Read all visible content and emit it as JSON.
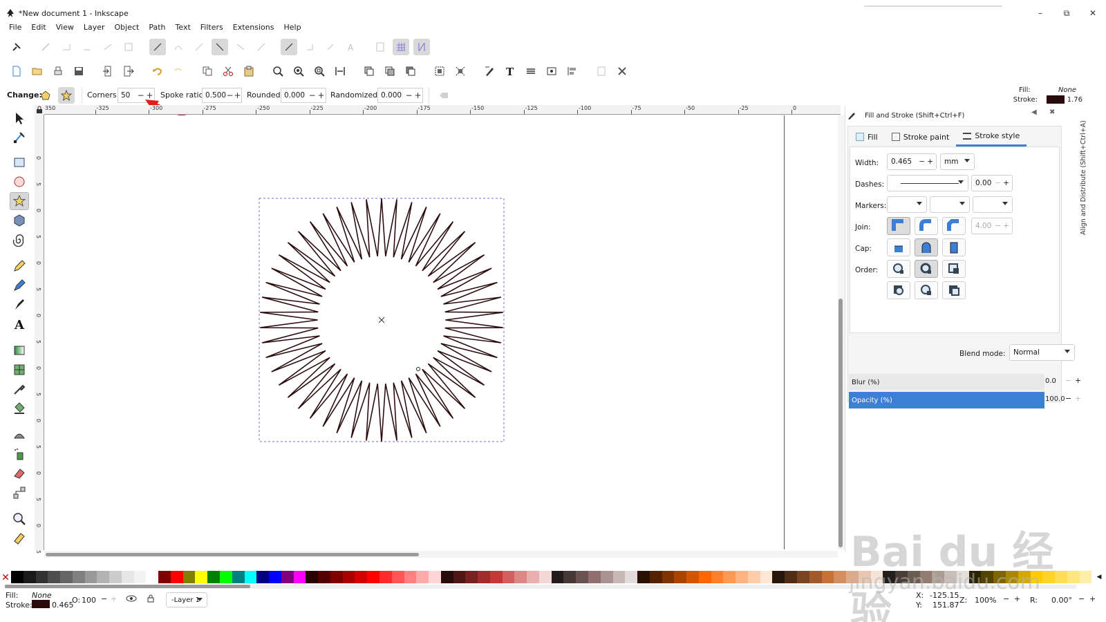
{
  "window": {
    "title": "*New document 1 - Inkscape",
    "minimize_glyph": "–",
    "maximize_glyph": "⧉",
    "close_glyph": "✕"
  },
  "menubar": [
    "File",
    "Edit",
    "View",
    "Layer",
    "Object",
    "Path",
    "Text",
    "Filters",
    "Extensions",
    "Help"
  ],
  "star_controls": {
    "change_label": "Change:",
    "corners_label": "Corners:",
    "corners_value": "50",
    "spoke_label": "Spoke ratio:",
    "spoke_value": "0.500",
    "rounded_label": "Rounded:",
    "rounded_value": "0.000",
    "randomized_label": "Randomized:",
    "randomized_value": "0.000",
    "minus": "−",
    "plus": "+"
  },
  "style_indicator": {
    "fill_label": "Fill:",
    "fill_value": "None",
    "stroke_label": "Stroke:",
    "stroke_value": "1.76",
    "stroke_color": "#2a0a0a"
  },
  "rulers": {
    "h_ticks": [
      "-350",
      "-325",
      "-300",
      "-275",
      "-250",
      "-225",
      "-200",
      "-175",
      "-150",
      "-125",
      "-100",
      "-75",
      "-50",
      "-25",
      "0"
    ],
    "v_ticks": [
      "0",
      "5",
      "0",
      "5",
      "0",
      "5",
      "0",
      "5",
      "0",
      "5",
      "0",
      "5",
      "0",
      "5",
      "0",
      "5"
    ]
  },
  "canvas": {
    "star_corners": 50,
    "spoke_ratio": 0.5,
    "stroke_color": "#2b0d10",
    "bbox_color": "#6b6bd6"
  },
  "dock": {
    "title": "Fill and Stroke (Shift+Ctrl+F)",
    "vertical_tab": "Align and Distribute (Shift+Ctrl+A)",
    "tabs": [
      "Fill",
      "Stroke paint",
      "Stroke style"
    ],
    "width_label": "Width:",
    "width_value": "0.465",
    "width_unit": "mm",
    "dashes_label": "Dashes:",
    "dash_offset": "0.00",
    "markers_label": "Markers:",
    "join_label": "Join:",
    "miter_value": "4.00",
    "cap_label": "Cap:",
    "order_label": "Order:",
    "blend_label": "Blend mode:",
    "blend_value": "Normal",
    "blur_label": "Blur (%)",
    "blur_value": "0.0",
    "opacity_label": "Opacity (%)",
    "opacity_value": "100.0",
    "accent_color": "#3b80d6"
  },
  "palette": {
    "none_glyph": "✕",
    "colors": [
      "#000000",
      "#1a1a1a",
      "#333333",
      "#4d4d4d",
      "#666666",
      "#808080",
      "#999999",
      "#b3b3b3",
      "#cccccc",
      "#e6e6e6",
      "#f2f2f2",
      "#ffffff",
      "#800000",
      "#ff0000",
      "#808000",
      "#ffff00",
      "#008000",
      "#00ff00",
      "#008080",
      "#00ffff",
      "#000080",
      "#0000ff",
      "#800080",
      "#ff00ff",
      "#2b0000",
      "#550000",
      "#800000",
      "#aa0000",
      "#d40000",
      "#ff0000",
      "#ff2a2a",
      "#ff5555",
      "#ff8080",
      "#ffaaaa",
      "#ffd5d5",
      "#280b0b",
      "#501616",
      "#782121",
      "#a02c2c",
      "#c83737",
      "#d35f5f",
      "#de8787",
      "#e9afaf",
      "#f4d7d7",
      "#241c1c",
      "#483737",
      "#6c5353",
      "#916f6f",
      "#ac9393",
      "#c8b7b7",
      "#e3dbdb",
      "#2b1100",
      "#552200",
      "#803300",
      "#aa4400",
      "#d45500",
      "#ff6600",
      "#ff7f2a",
      "#ff9955",
      "#ffb380",
      "#ffccaa",
      "#ffe6d5",
      "#28170b",
      "#502d16",
      "#784421",
      "#a05a2c",
      "#c87137",
      "#d38d5f",
      "#deaa87",
      "#e9c6af",
      "#f4e3d7",
      "#241f1c",
      "#483e37",
      "#6c5d53",
      "#917c6f",
      "#ac9d93",
      "#c8beb7",
      "#e3dedb",
      "#2b2200",
      "#554400",
      "#806600",
      "#aa8800",
      "#d4aa00",
      "#ffcc00",
      "#ffd42a",
      "#ffdd55",
      "#ffe680",
      "#ffeeaa"
    ]
  },
  "statusbar": {
    "fill_label": "Fill:",
    "fill_value": "None",
    "stroke_label": "Stroke:",
    "stroke_value": "0.465",
    "opacity_label": "O:",
    "opacity_value": "100",
    "layer": "-Layer 1",
    "x_label": "X:",
    "x_value": "-125.15",
    "y_label": "Y:",
    "y_value": "151.87",
    "zoom_label": "Z:",
    "zoom_value": "100%",
    "rotate_label": "R:",
    "rotate_value": "0.00°"
  },
  "watermark": {
    "main": "Bai du 经验",
    "sub": "jingyan.baidu.com"
  }
}
